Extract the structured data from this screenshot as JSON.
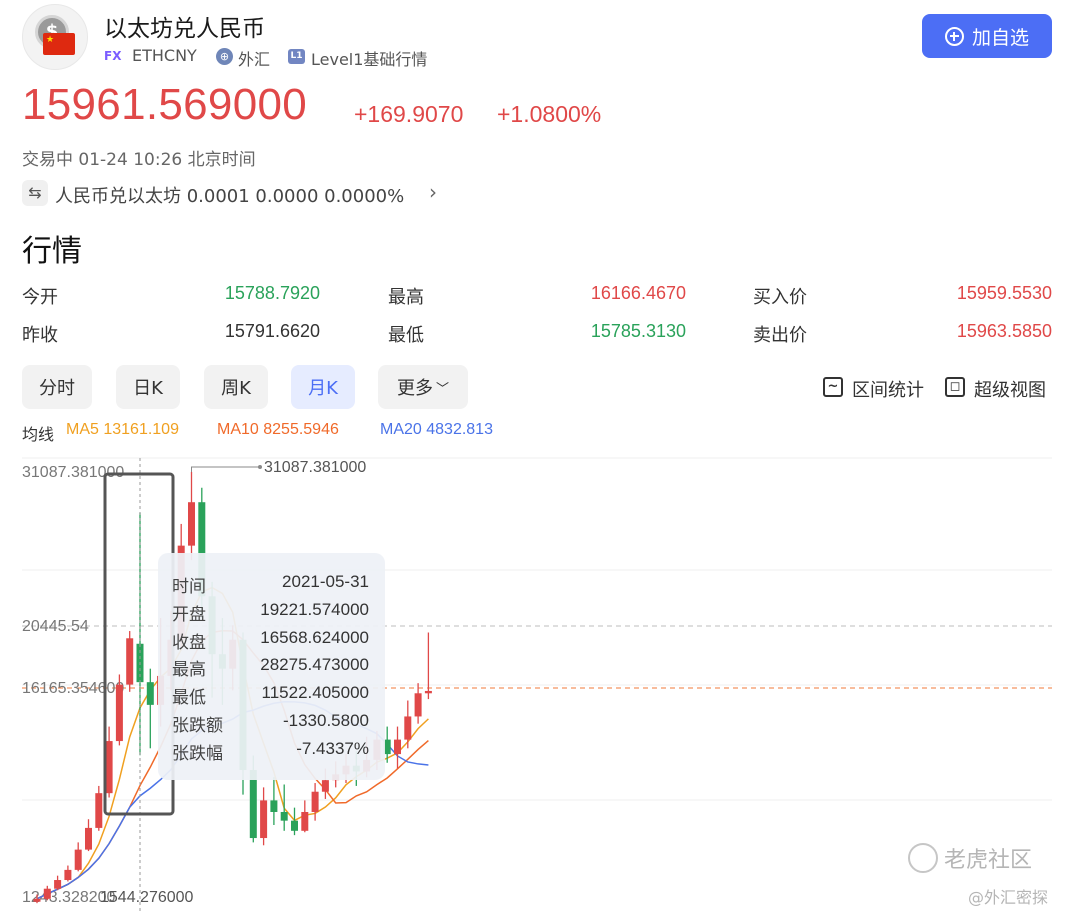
{
  "header": {
    "title": "以太坊兑人民币",
    "fx_tag": "FX",
    "code": "ETHCNY",
    "forex_label": "外汇",
    "level_icon": "L1",
    "level_label": "Level1基础行情",
    "add_button": "加自选",
    "coin_symbol": "$"
  },
  "quote": {
    "price": "15961.569000",
    "change": "+169.9070",
    "change_pct": "+1.0800%",
    "status": "交易中 01-24 10:26 北京时间",
    "reverse": "人民币兑以太坊 0.0001 0.0000 0.0000%"
  },
  "section_title": "行情",
  "stats": {
    "open_label": "今开",
    "open": "15788.7920",
    "prev_label": "昨收",
    "prev": "15791.6620",
    "high_label": "最高",
    "high": "16166.4670",
    "low_label": "最低",
    "low": "15785.3130",
    "bid_label": "买入价",
    "bid": "15959.5530",
    "ask_label": "卖出价",
    "ask": "15963.5850"
  },
  "tabs": [
    "分时",
    "日K",
    "周K",
    "月K",
    "更多"
  ],
  "tools": {
    "range_stats": "区间统计",
    "super_view": "超级视图"
  },
  "ma": {
    "label": "均线",
    "ma5": "MA5 13161.109",
    "ma10": "MA10 8255.5946",
    "ma20": "MA20 4832.813",
    "colors": {
      "ma5": "#f0a020",
      "ma10": "#f06a2a",
      "ma20": "#4a73e8"
    }
  },
  "tooltip": {
    "time_label": "时间",
    "time": "2021-05-31",
    "open_label": "开盘",
    "open": "19221.574000",
    "close_label": "收盘",
    "close": "16568.624000",
    "high_label": "最高",
    "high": "28275.473000",
    "low_label": "最低",
    "low": "11522.405000",
    "chg_label": "张跌额",
    "chg": "-1330.5800",
    "pct_label": "张跌幅",
    "pct": "-7.4337%"
  },
  "chart_data": {
    "type": "candlestick",
    "colors": {
      "up": "#e04848",
      "down": "#2aa25a"
    },
    "y_labels": [
      "31087.381000",
      "20445.54",
      "16165.354600",
      "1243.328200"
    ],
    "max_label": "31087.381000",
    "min_label": "1544.276000",
    "ref_lines": [
      20445.54,
      16165.3546
    ],
    "ylim": [
      1243.3282,
      31087.381
    ],
    "candles": [
      {
        "o": 1400,
        "c": 1600,
        "h": 1900,
        "l": 1300
      },
      {
        "o": 1600,
        "c": 2300,
        "h": 2500,
        "l": 1500
      },
      {
        "o": 2300,
        "c": 2900,
        "h": 3200,
        "l": 2200
      },
      {
        "o": 2900,
        "c": 3600,
        "h": 3900,
        "l": 2800
      },
      {
        "o": 3600,
        "c": 5000,
        "h": 5500,
        "l": 3500
      },
      {
        "o": 5000,
        "c": 6500,
        "h": 7100,
        "l": 4900
      },
      {
        "o": 6500,
        "c": 8900,
        "h": 9400,
        "l": 6300
      },
      {
        "o": 8900,
        "c": 12500,
        "h": 13500,
        "l": 8600
      },
      {
        "o": 12500,
        "c": 16400,
        "h": 17100,
        "l": 12200
      },
      {
        "o": 16400,
        "c": 19600,
        "h": 20100,
        "l": 15900
      },
      {
        "o": 19221.574,
        "c": 16568.624,
        "h": 28275.473,
        "l": 11522.405
      },
      {
        "o": 16568,
        "c": 15000,
        "h": 17500,
        "l": 12000
      },
      {
        "o": 15000,
        "c": 17000,
        "h": 21000,
        "l": 13500
      },
      {
        "o": 17000,
        "c": 19500,
        "h": 21500,
        "l": 16000
      },
      {
        "o": 19500,
        "c": 26000,
        "h": 27500,
        "l": 19000
      },
      {
        "o": 26000,
        "c": 29000,
        "h": 31087.381,
        "l": 25000
      },
      {
        "o": 29000,
        "c": 22500,
        "h": 30000,
        "l": 21000
      },
      {
        "o": 22500,
        "c": 18500,
        "h": 23500,
        "l": 15500
      },
      {
        "o": 18500,
        "c": 17500,
        "h": 21000,
        "l": 15000
      },
      {
        "o": 17500,
        "c": 19500,
        "h": 20500,
        "l": 16000
      },
      {
        "o": 19500,
        "c": 10500,
        "h": 20000,
        "l": 8800
      },
      {
        "o": 10500,
        "c": 5800,
        "h": 11500,
        "l": 5500
      },
      {
        "o": 5800,
        "c": 8400,
        "h": 9300,
        "l": 5300
      },
      {
        "o": 8400,
        "c": 7600,
        "h": 10000,
        "l": 6700
      },
      {
        "o": 7600,
        "c": 7000,
        "h": 9500,
        "l": 6300
      },
      {
        "o": 7000,
        "c": 6300,
        "h": 7900,
        "l": 6000
      },
      {
        "o": 6300,
        "c": 7600,
        "h": 8400,
        "l": 6200
      },
      {
        "o": 7600,
        "c": 9000,
        "h": 9600,
        "l": 7000
      },
      {
        "o": 9000,
        "c": 9800,
        "h": 10600,
        "l": 8500
      },
      {
        "o": 9800,
        "c": 10200,
        "h": 11100,
        "l": 9300
      },
      {
        "o": 10200,
        "c": 10800,
        "h": 11600,
        "l": 9600
      },
      {
        "o": 10800,
        "c": 10400,
        "h": 11800,
        "l": 9400
      },
      {
        "o": 10400,
        "c": 11200,
        "h": 12800,
        "l": 10000
      },
      {
        "o": 11200,
        "c": 12600,
        "h": 13200,
        "l": 10500
      },
      {
        "o": 12600,
        "c": 11600,
        "h": 13500,
        "l": 11000
      },
      {
        "o": 11600,
        "c": 12600,
        "h": 13500,
        "l": 10600
      },
      {
        "o": 12600,
        "c": 14200,
        "h": 15300,
        "l": 12000
      },
      {
        "o": 14200,
        "c": 15800,
        "h": 16500,
        "l": 13700
      },
      {
        "o": 15800,
        "c": 15961.569,
        "h": 20000,
        "l": 15400
      }
    ]
  },
  "watermark": {
    "main": "老虎社区",
    "sub": "@外汇密探"
  }
}
